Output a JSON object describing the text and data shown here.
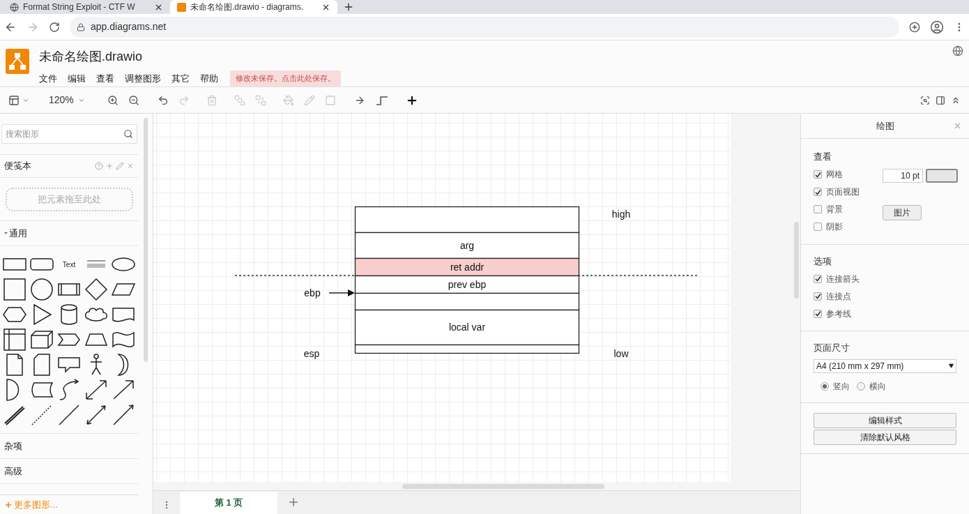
{
  "browser": {
    "tabs": [
      {
        "title": "Format String Exploit - CTF W",
        "selected": false
      },
      {
        "title": "未命名绘图.drawio - diagrams.",
        "selected": true
      }
    ],
    "url": "app.diagrams.net"
  },
  "app": {
    "title": "未命名绘图.drawio",
    "menu": [
      "文件",
      "编辑",
      "查看",
      "调整图形",
      "其它",
      "帮助"
    ],
    "unsaved_notice": "修改未保存。点击此处保存。"
  },
  "toolbar": {
    "zoom": "120%"
  },
  "sidebar": {
    "search": {
      "placeholder": "搜索图形"
    },
    "scratchpad": {
      "title": "便笺本",
      "drop_hint": "把元素拖至此处"
    },
    "general": {
      "title": "通用",
      "expanded": true,
      "shapes": [
        {
          "kind": "rect"
        },
        {
          "kind": "rounded"
        },
        {
          "kind": "text",
          "label": "Text"
        },
        {
          "kind": "textbox"
        },
        {
          "kind": "ellipse"
        },
        {
          "kind": "square"
        },
        {
          "kind": "circle"
        },
        {
          "kind": "process"
        },
        {
          "kind": "diamond"
        },
        {
          "kind": "parallelogram"
        },
        {
          "kind": "hexagon"
        },
        {
          "kind": "triangle"
        },
        {
          "kind": "cylinder"
        },
        {
          "kind": "cloud"
        },
        {
          "kind": "document"
        },
        {
          "kind": "internal"
        },
        {
          "kind": "cube"
        },
        {
          "kind": "step"
        },
        {
          "kind": "trapezoid"
        },
        {
          "kind": "tape"
        },
        {
          "kind": "note"
        },
        {
          "kind": "card"
        },
        {
          "kind": "callout"
        },
        {
          "kind": "actor"
        },
        {
          "kind": "or"
        },
        {
          "kind": "and"
        },
        {
          "kind": "data"
        },
        {
          "kind": "curve"
        },
        {
          "kind": "bidir-arrow"
        },
        {
          "kind": "arrow"
        },
        {
          "kind": "link"
        },
        {
          "kind": "dashed"
        },
        {
          "kind": "line"
        },
        {
          "kind": "bidir-line"
        },
        {
          "kind": "directional"
        }
      ]
    },
    "sections": [
      "杂项",
      "高级"
    ],
    "more_shapes": "更多图形..."
  },
  "diagram": {
    "cells": [
      {
        "color": "#ffffff"
      },
      {
        "label": "arg",
        "color": "#ffffff"
      },
      {
        "label": "ret addr",
        "color": "#f8cecc"
      },
      {
        "label": "prev ebp",
        "color": "#ffffff"
      },
      {
        "color": "#ffffff"
      },
      {
        "label": "local var",
        "color": "#ffffff"
      },
      {
        "color": "#ffffff"
      }
    ],
    "labels": [
      "high",
      "ebp",
      "esp",
      "low"
    ]
  },
  "pages": [
    {
      "label": "第 1 页",
      "selected": true
    }
  ],
  "format_panel": {
    "title": "绘图",
    "view": {
      "title": "查看",
      "options": [
        {
          "label": "网格",
          "checked": true
        },
        {
          "label": "页面视图",
          "checked": true
        },
        {
          "label": "背景",
          "checked": false
        },
        {
          "label": "阴影",
          "checked": false
        }
      ],
      "grid_size": "10 pt",
      "image_button": "图片"
    },
    "options": {
      "title": "选项",
      "options": [
        {
          "label": "连接箭头",
          "checked": true
        },
        {
          "label": "连接点",
          "checked": true
        },
        {
          "label": "参考线",
          "checked": true
        }
      ]
    },
    "paper": {
      "title": "页面尺寸",
      "size": "A4 (210 mm x 297 mm)",
      "orientation": [
        {
          "label": "竖向",
          "selected": true
        },
        {
          "label": "横向",
          "selected": false
        }
      ]
    },
    "buttons": [
      "编辑样式",
      "清除默认风格"
    ]
  }
}
